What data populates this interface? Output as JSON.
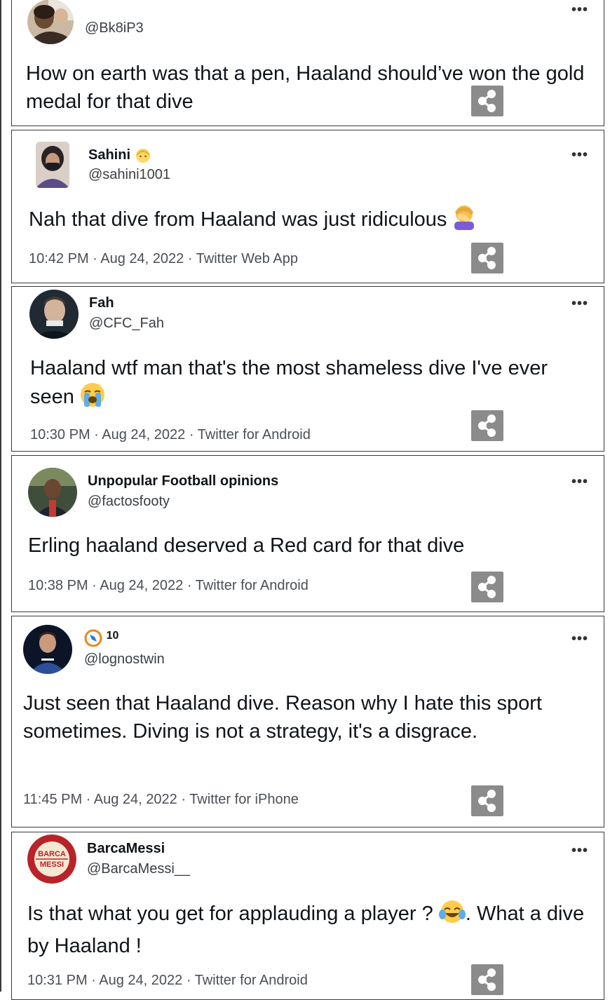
{
  "colors": {
    "border": "#3a3a3a",
    "share_bg": "#8b8b8b",
    "meta": "#4a4f55"
  },
  "tweets": [
    {
      "name": "",
      "handle": "@Bk8iP3",
      "text": "How on earth was that a pen, Haaland should’ve won the gold medal for that dive",
      "meta": "",
      "icons": [
        "avatar",
        "more-icon",
        "share-icon"
      ]
    },
    {
      "name": "Sahini",
      "name_emoji": "person-emoji",
      "handle": "@sahini1001",
      "text": "Nah that dive from Haaland was just ridiculous",
      "text_emoji": "facepalm-emoji",
      "meta": "10:42 PM · Aug 24, 2022 · Twitter Web App"
    },
    {
      "name": "Fah",
      "handle": "@CFC_Fah",
      "text": "Haaland wtf man that's the most shameless dive I've ever seen",
      "text_emoji": "loudly-crying-emoji",
      "meta": "10:30 PM · Aug 24, 2022 · Twitter for Android"
    },
    {
      "name": "Unpopular Football opinions",
      "handle": "@factosfooty",
      "text": "Erling haaland deserved a Red card for that dive",
      "meta": "10:38 PM · Aug 24, 2022 · Twitter for Android"
    },
    {
      "name": "10",
      "name_emoji": "compass-emoji",
      "handle": "@lognostwin",
      "text": "Just seen that Haaland dive. Reason why I hate this sport sometimes. Diving is not a strategy, it's a disgrace.",
      "meta": "11:45 PM · Aug 24, 2022 · Twitter for iPhone"
    },
    {
      "name": "BarcaMessi",
      "handle": "@BarcaMessi__",
      "avatar_text": [
        "BARCA",
        "MESSI"
      ],
      "text_a": "Is that what you get for applauding a player ?",
      "text_emoji": "tears-of-joy-emoji",
      "text_b": ". What a dive by Haaland !",
      "meta": "10:31 PM · Aug 24, 2022 · Twitter for Android"
    }
  ],
  "more_label": "•••"
}
